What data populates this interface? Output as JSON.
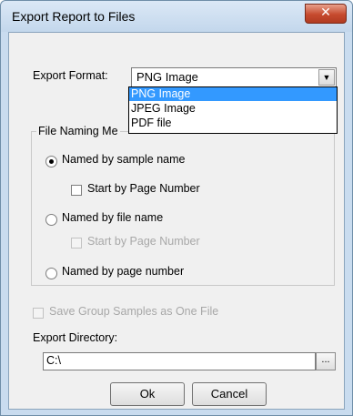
{
  "window": {
    "title": "Export Report to Files",
    "close_glyph": "✕"
  },
  "export_format": {
    "label": "Export Format:",
    "value": "PNG Image",
    "options": [
      "PNG Image",
      "JPEG Image",
      "PDF file"
    ]
  },
  "naming_group": {
    "label": "File Naming Me",
    "named_by_sample": "Named by sample name",
    "start_page_1": "Start by Page Number",
    "named_by_file": "Named by file name",
    "start_page_2": "Start by Page Number",
    "named_by_page": "Named by page number"
  },
  "save_group": "Save Group Samples as One File",
  "export_directory": {
    "label": "Export Directory:",
    "value": "C:\\",
    "browse_label": "..."
  },
  "buttons": {
    "ok": "Ok",
    "cancel": "Cancel"
  },
  "colors": {
    "selection": "#3399ff",
    "close": "#c64a2e",
    "frame": "#c9dcef"
  }
}
